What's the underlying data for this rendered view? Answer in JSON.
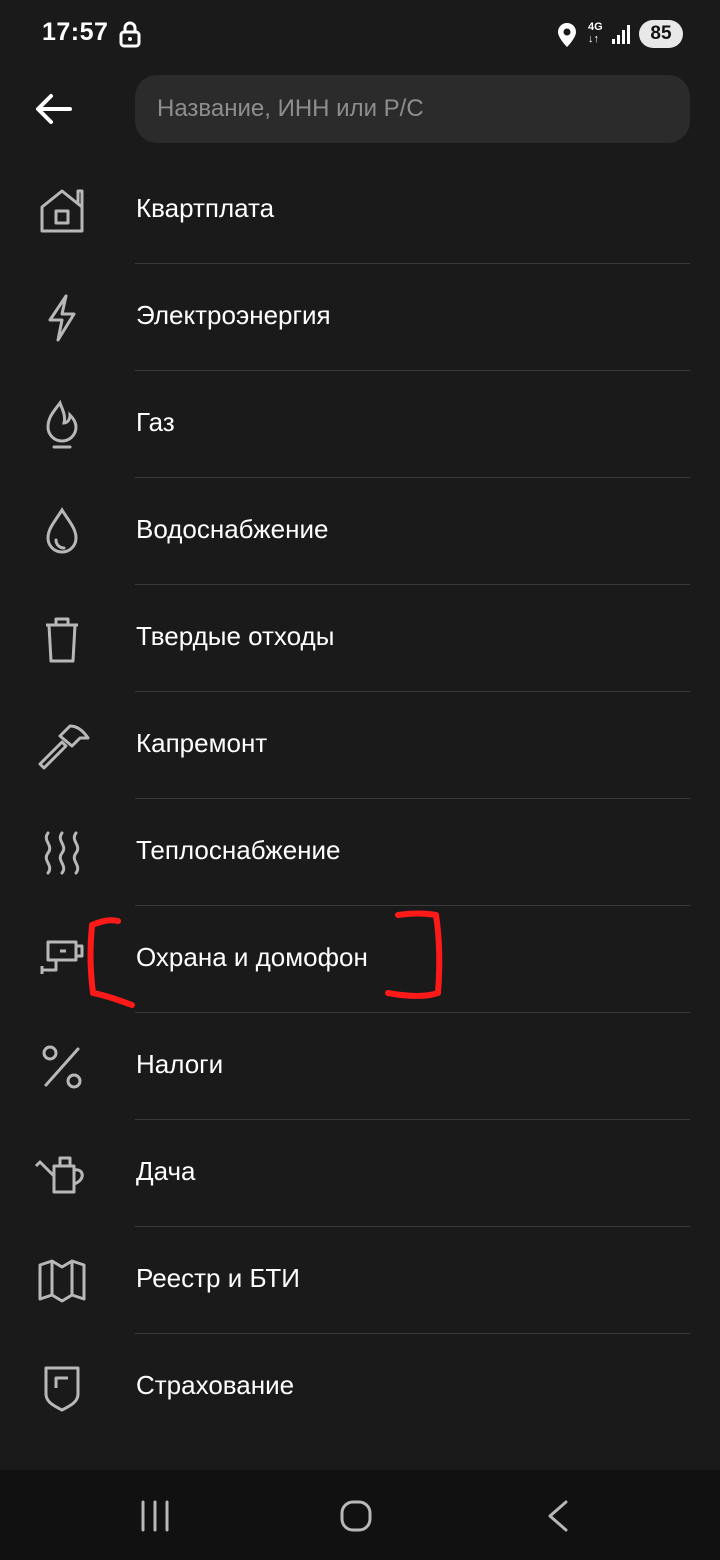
{
  "status_bar": {
    "time": "17:57",
    "network": "4G",
    "network_arrows": "↓↑",
    "battery": "85",
    "icons": [
      "lock-icon",
      "location-icon",
      "signal-icon"
    ]
  },
  "search": {
    "placeholder": "Название, ИНН или Р/С",
    "value": ""
  },
  "categories": [
    {
      "label": "Квартплата",
      "icon": "house-icon"
    },
    {
      "label": "Электроэнергия",
      "icon": "lightning-icon"
    },
    {
      "label": "Газ",
      "icon": "gas-flame-icon"
    },
    {
      "label": "Водоснабжение",
      "icon": "water-drop-icon"
    },
    {
      "label": "Твердые отходы",
      "icon": "trash-bin-icon"
    },
    {
      "label": "Капремонт",
      "icon": "hammer-icon"
    },
    {
      "label": "Теплоснабжение",
      "icon": "heat-waves-icon"
    },
    {
      "label": "Охрана и домофон",
      "icon": "security-camera-icon"
    },
    {
      "label": "Налоги",
      "icon": "percent-icon"
    },
    {
      "label": "Дача",
      "icon": "watering-can-icon"
    },
    {
      "label": "Реестр и БТИ",
      "icon": "map-icon"
    },
    {
      "label": "Страхование",
      "icon": "shield-icon"
    }
  ],
  "annotation": {
    "color": "#ff1a1a",
    "highlighted_item": "Охрана и домофон"
  },
  "nav_bar": {
    "icons": [
      "recent-apps-icon",
      "home-icon",
      "back-nav-icon"
    ]
  },
  "colors": {
    "background": "#1a1a1a",
    "search_bg": "#2b2b2b",
    "icon": "#b8b8b8",
    "divider": "#3a3a3a"
  }
}
